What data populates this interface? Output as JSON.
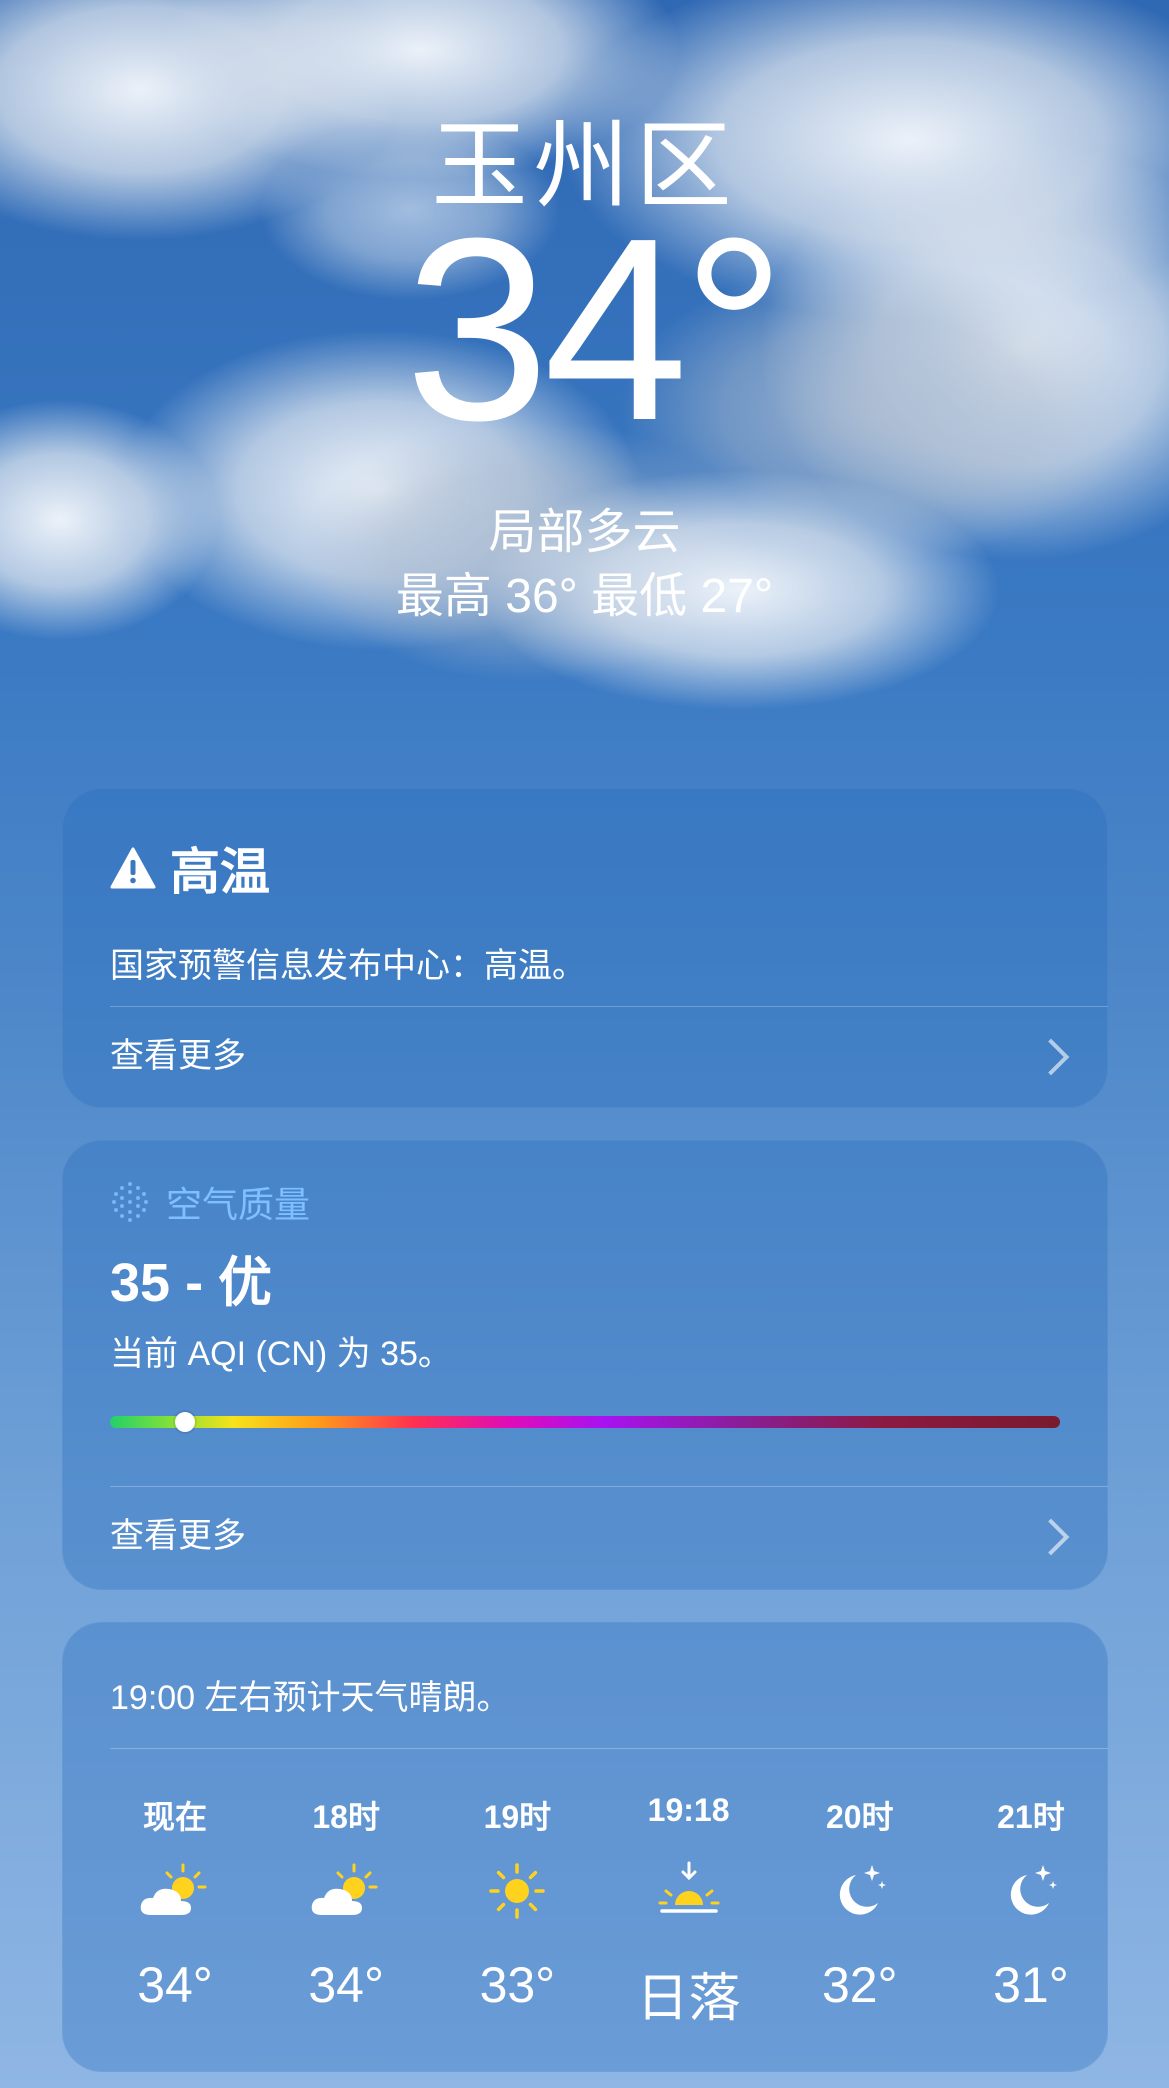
{
  "location": {
    "city": "玉州区",
    "temperature": "34°",
    "condition": "局部多云",
    "hi_lo": "最高 36°  最低 27°"
  },
  "alert": {
    "icon": "warning-triangle-icon",
    "title": "高温",
    "body": "国家预警信息发布中心：高温。",
    "more": "查看更多"
  },
  "air_quality": {
    "icon": "air-quality-dots-icon",
    "label": "空气质量",
    "value": "35 - 优",
    "description": "当前 AQI (CN) 为 35。",
    "more": "查看更多",
    "scale_position": 0.075
  },
  "hourly": {
    "summary": "19:00 左右预计天气晴朗。",
    "items": [
      {
        "time": "现在",
        "icon": "partly-cloudy-sun-icon",
        "value": "34°"
      },
      {
        "time": "18时",
        "icon": "partly-cloudy-sun-icon",
        "value": "34°"
      },
      {
        "time": "19时",
        "icon": "sun-icon",
        "value": "33°"
      },
      {
        "time": "19:18",
        "icon": "sunset-icon",
        "value": "日落"
      },
      {
        "time": "20时",
        "icon": "moon-stars-icon",
        "value": "32°"
      },
      {
        "time": "21时",
        "icon": "moon-stars-icon",
        "value": "31°"
      }
    ]
  },
  "colors": {
    "accent_label": "#7ec0ff",
    "sun": "#ffd21e"
  }
}
